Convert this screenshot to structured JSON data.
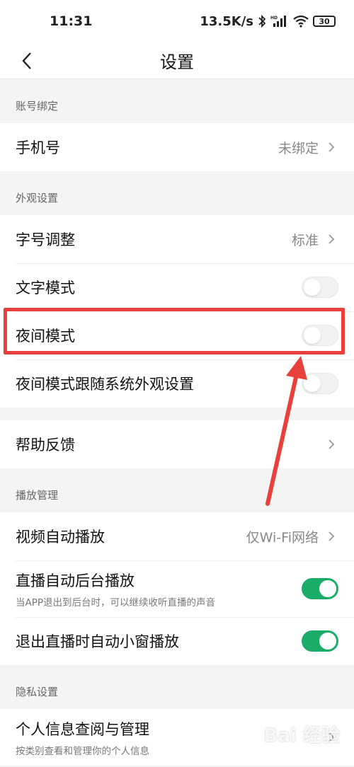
{
  "status_bar": {
    "time": "11:31",
    "network_speed": "13.5K/s",
    "battery": "30",
    "icons": [
      "bluetooth-icon",
      "signal-icon",
      "wifi-icon",
      "battery-icon"
    ]
  },
  "header": {
    "title": "设置",
    "back_icon": "chevron-left-icon"
  },
  "sections": {
    "account": {
      "header": "账号绑定",
      "phone": {
        "label": "手机号",
        "value": "未绑定"
      }
    },
    "appearance": {
      "header": "外观设置",
      "font_size": {
        "label": "字号调整",
        "value": "标准"
      },
      "text_mode": {
        "label": "文字模式",
        "on": false
      },
      "night_mode": {
        "label": "夜间模式",
        "on": false
      },
      "night_follow_system": {
        "label": "夜间模式跟随系统外观设置",
        "on": false
      }
    },
    "help": {
      "feedback": {
        "label": "帮助反馈"
      }
    },
    "playback": {
      "header": "播放管理",
      "video_autoplay": {
        "label": "视频自动播放",
        "value": "仅Wi-Fi网络"
      },
      "live_background": {
        "label": "直播自动后台播放",
        "sub": "当APP退出到后台时，可以继续收听直播的声音",
        "on": true
      },
      "live_mini_window": {
        "label": "退出直播时自动小窗播放",
        "on": true
      }
    },
    "privacy": {
      "header": "隐私设置",
      "personal_info": {
        "label": "个人信息查阅与管理",
        "sub": "按类别查看和管理你的个人信息"
      }
    }
  },
  "overlay": {
    "highlight_color": "#e8413b",
    "watermark": "Bai 经验"
  },
  "colors": {
    "toggle_on": "#1aad6a",
    "background": "#f4f4f4"
  }
}
